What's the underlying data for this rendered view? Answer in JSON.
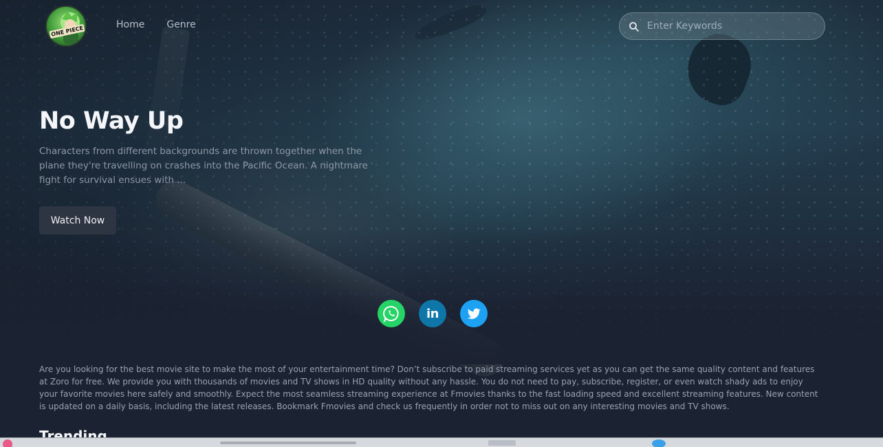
{
  "brand": {
    "logo_text": "ONE PIECE"
  },
  "nav": {
    "home": "Home",
    "genre": "Genre"
  },
  "search": {
    "placeholder": "Enter Keywords",
    "value": ""
  },
  "hero": {
    "title": "No Way Up",
    "description": "Characters from different backgrounds are thrown together when the plane they're travelling on crashes into the Pacific Ocean. A nightmare fight for survival ensues with ...",
    "watch_label": "Watch Now"
  },
  "social": {
    "linkedin_glyph": "in"
  },
  "about": {
    "text": "Are you looking for the best movie site to make the most of your entertainment time? Don’t subscribe to paid streaming services yet as you can get the same quality content and features at Zoro for free. We provide you with thousands of movies and TV shows in HD quality without any hassle. You do not need to pay, subscribe, register, or even watch shady ads to enjoy your favorite movies here safely and smoothly. Expect the most seamless streaming experience at Fmovies thanks to the fast loading speed and excellent streaming features. New content is updated on a daily basis, including the latest releases. Bookmark Fmovies and check us frequently in order not to miss out on any interesting movies and TV shows."
  },
  "trending": {
    "heading": "Trending"
  },
  "colors": {
    "background": "#1b2232",
    "whatsapp": "#25d366",
    "linkedin": "#0e76a8",
    "twitter": "#1da1f2",
    "button": "#2e3542"
  },
  "icons": {
    "search": "search-icon",
    "whatsapp": "whatsapp-icon",
    "linkedin": "linkedin-icon",
    "twitter": "twitter-icon"
  }
}
